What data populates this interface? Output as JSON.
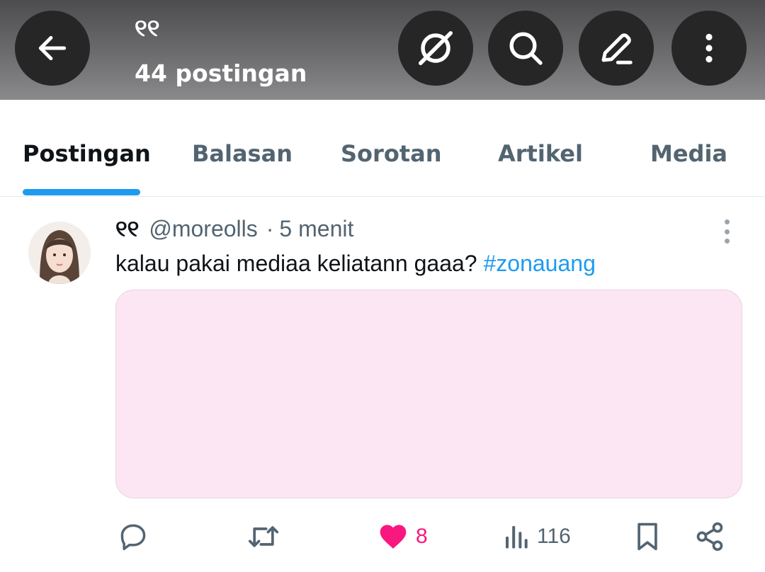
{
  "header": {
    "title": "୧୧",
    "post_count": "44 postingan"
  },
  "tabs": [
    {
      "label": "Postingan",
      "active": true
    },
    {
      "label": "Balasan",
      "active": false
    },
    {
      "label": "Sorotan",
      "active": false
    },
    {
      "label": "Artikel",
      "active": false
    },
    {
      "label": "Media",
      "active": false
    }
  ],
  "post": {
    "display_name": "୧୧",
    "handle": "@moreolls",
    "separator": "·",
    "time": "5 menit",
    "text": "kalau pakai mediaa keliatann gaaa? ",
    "hashtag": "#zonauang",
    "actions": {
      "likes": "8",
      "views": "116"
    }
  },
  "icons": {
    "back": "arrow-left-icon",
    "grok": "grok-icon",
    "search": "search-icon",
    "compose": "compose-icon",
    "more": "more-vertical-icon",
    "reply": "reply-icon",
    "retweet": "retweet-icon",
    "like": "heart-icon",
    "views": "views-icon",
    "bookmark": "bookmark-icon",
    "share": "share-icon"
  },
  "colors": {
    "accent": "#1d9bf0",
    "like": "#f91880",
    "muted": "#536471",
    "media_bg": "#fce6f3"
  }
}
